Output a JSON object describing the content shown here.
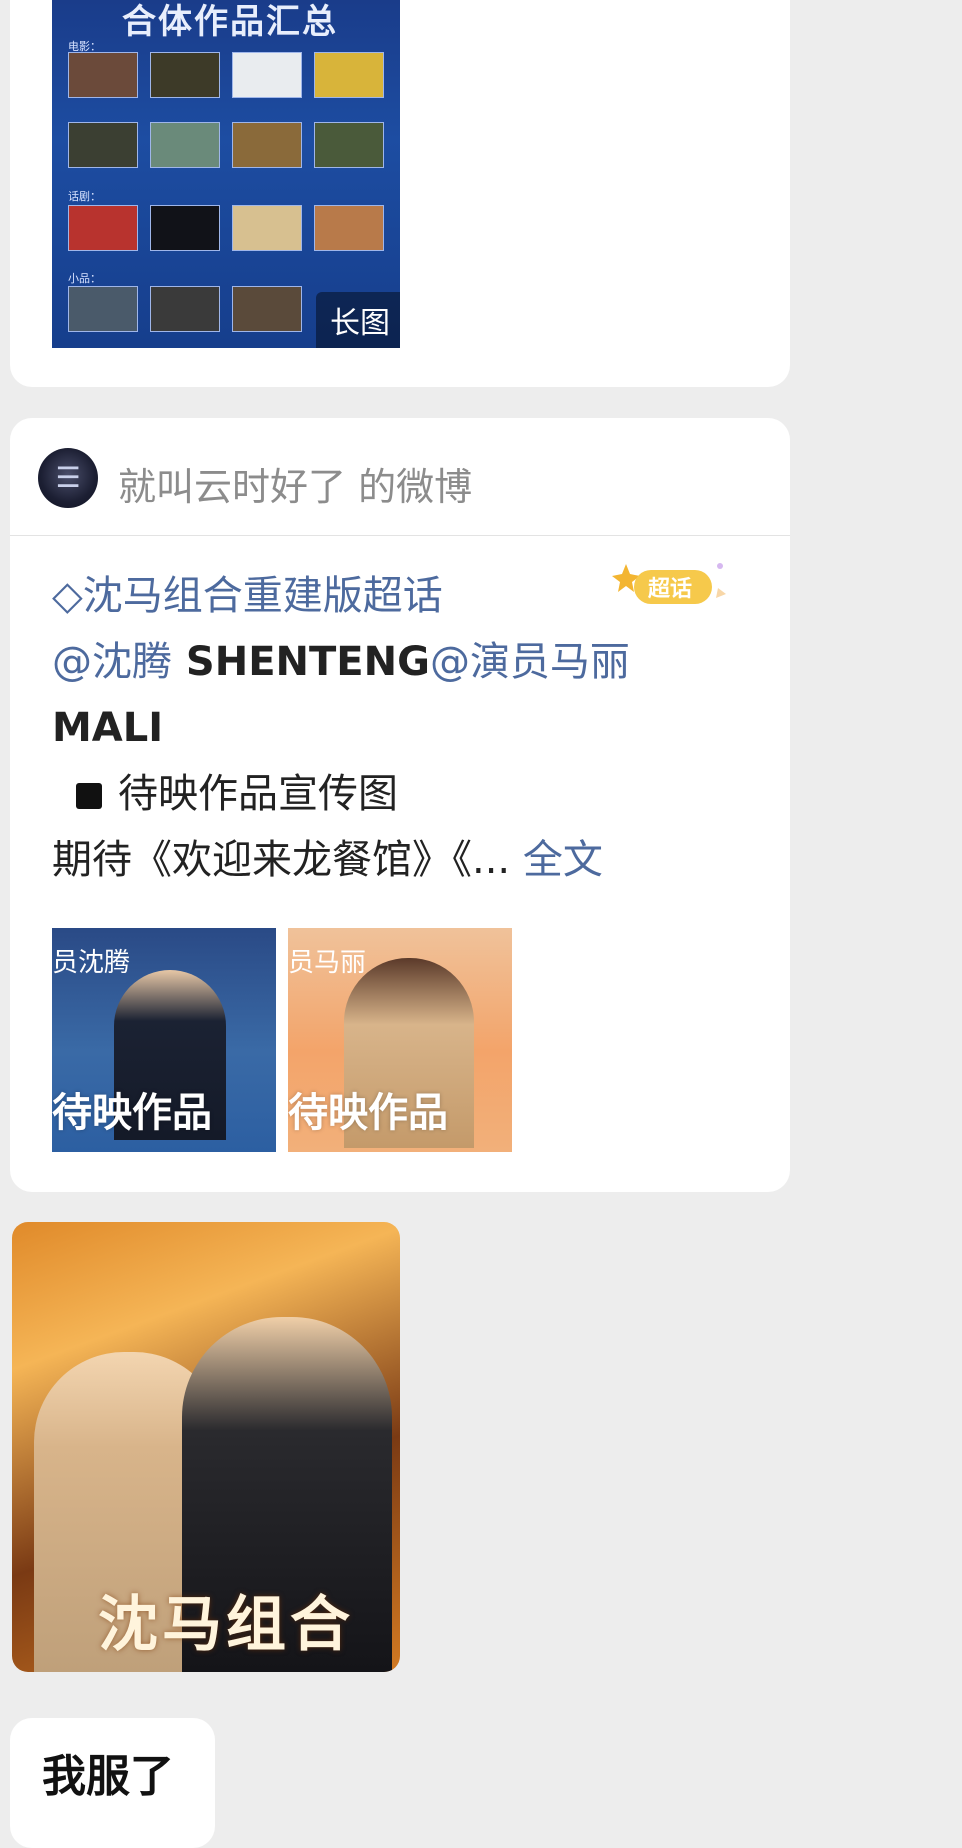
{
  "long_image_card": {
    "title": "合体作品汇总",
    "sections": [
      "电影：",
      "话剧：",
      "小品："
    ],
    "badge": "长图"
  },
  "weibo_card": {
    "source": "就叫云时好了 的微博",
    "supertopic_tag": "沈马组合重建版超话",
    "mention_1": "@沈腾",
    "mention_1_name": " SHENTENG",
    "mention_2": "@演员马丽",
    "mention_2_name": "MALI",
    "line_3": "待映作品宣传图",
    "line_4": "期待《欢迎来龙餐馆》《...",
    "full_text_link": "全文",
    "supertopic_badge": "超话",
    "photos": [
      {
        "top_label": "员沈腾",
        "label": "待映作品"
      },
      {
        "top_label": "员马丽",
        "label": "待映作品"
      }
    ]
  },
  "poster": {
    "title": "沈马组合"
  },
  "message": {
    "text": "我服了"
  }
}
